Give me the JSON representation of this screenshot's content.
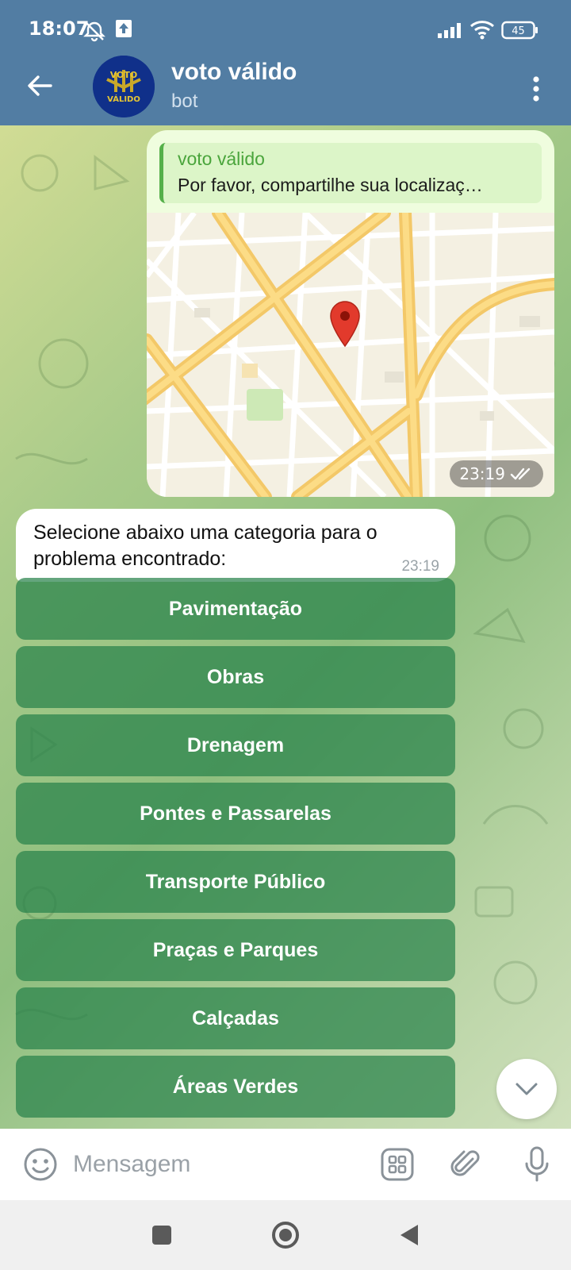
{
  "status_bar": {
    "time": "18:07",
    "battery": "45",
    "icons": [
      "mute-alarm-icon",
      "upload-icon",
      "signal-icon",
      "wifi-icon",
      "battery-icon"
    ]
  },
  "header": {
    "title": "voto válido",
    "subtitle": "bot",
    "avatar_text_top": "VOTO",
    "avatar_text_bottom": "VÁLIDO",
    "back_icon": "arrow-left-icon",
    "menu_icon": "more-vertical-icon"
  },
  "messages": {
    "outgoing": {
      "reply_name": "voto válido",
      "reply_text": "Por favor, compartilhe sua localizaç…",
      "time": "23:19",
      "type": "location"
    },
    "incoming": {
      "text": "Selecione abaixo uma categoria para o problema encontrado:",
      "time": "23:19"
    }
  },
  "keyboard": [
    "Pavimentação",
    "Obras",
    "Drenagem",
    "Pontes e Passarelas",
    "Transporte Público",
    "Praças e Parques",
    "Calçadas",
    "Áreas Verdes"
  ],
  "composer": {
    "placeholder": "Mensagem"
  },
  "colors": {
    "header": "#527da3",
    "outgoing_bubble": "#effdde",
    "keyboard_button": "#3f9061"
  }
}
